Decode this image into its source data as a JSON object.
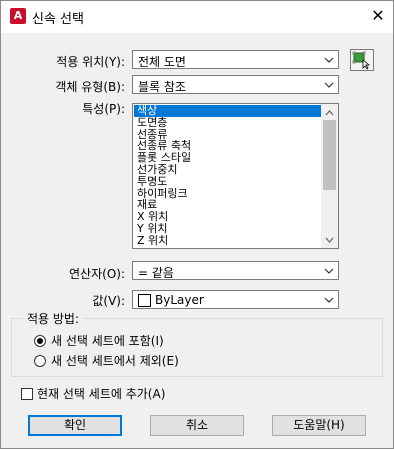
{
  "window": {
    "title": "신속 선택",
    "app_icon_letter": "A"
  },
  "fields": {
    "apply_to": {
      "label": "적용 위치(Y):",
      "value": "전체 도면"
    },
    "object_type": {
      "label": "객체 유형(B):",
      "value": "블록 참조"
    },
    "properties": {
      "label": "특성(P):",
      "items": [
        "색상",
        "도면층",
        "선종류",
        "선종류 축척",
        "플롯 스타일",
        "선가중치",
        "투명도",
        "하이퍼링크",
        "재료",
        "X 위치",
        "Y 위치",
        "Z 위치"
      ],
      "selected_index": 0
    },
    "operator": {
      "label": "연산자(O):",
      "value": "= 같음"
    },
    "value": {
      "label": "값(V):",
      "value": "ByLayer"
    }
  },
  "how_to_apply": {
    "title": "적용 방법:",
    "options": [
      {
        "label": "새 선택 세트에 포함(I)",
        "selected": true
      },
      {
        "label": "새 선택 세트에서 제외(E)",
        "selected": false
      }
    ]
  },
  "append": {
    "label": "현재 선택 세트에 추가(A)",
    "checked": false
  },
  "buttons": {
    "ok": "확인",
    "cancel": "취소",
    "help": "도움말(H)"
  },
  "colors": {
    "selection": "#0078d7",
    "icon_red": "#c8102e",
    "default_border": "#0078d7"
  },
  "icons": {
    "pick": "select-objects-icon",
    "close": "close-icon",
    "dropdown": "chevron-down-icon"
  }
}
